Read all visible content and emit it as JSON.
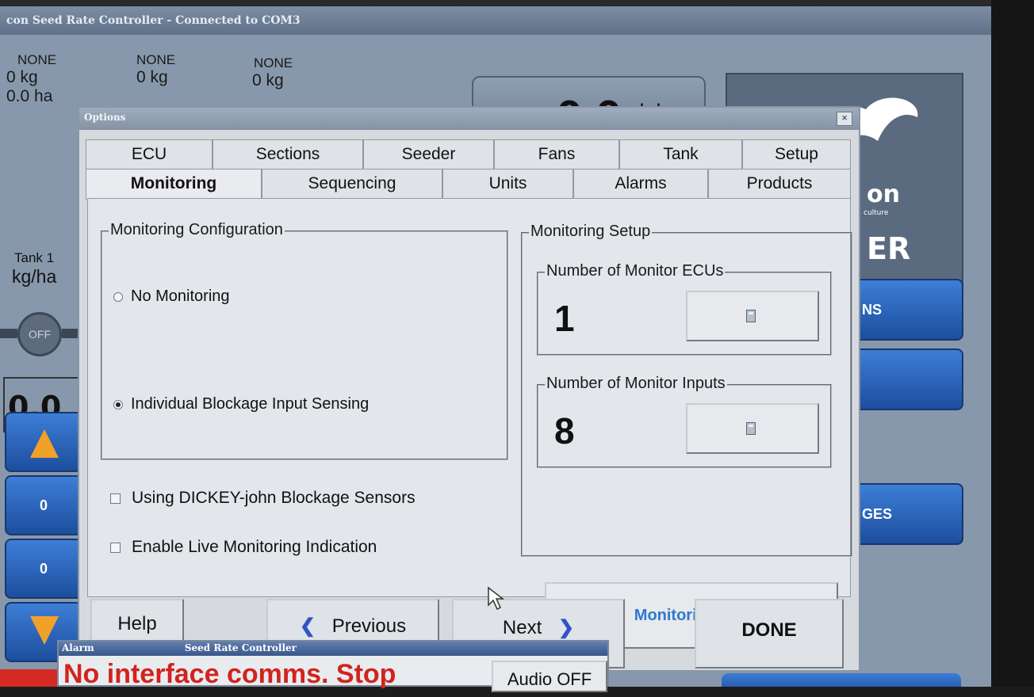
{
  "app": {
    "title": "con Seed Rate Controller - Connected to COM3",
    "stats": [
      {
        "name": "NONE",
        "mass": "0 kg",
        "area": "0.0 ha"
      },
      {
        "name": "NONE",
        "mass": "0 kg"
      },
      {
        "name": "NONE",
        "mass": "0 kg"
      }
    ],
    "speed": {
      "value": "0.0",
      "unit": "kph"
    },
    "logo": {
      "line1": "on",
      "sub": "culture",
      "line2": "ER"
    },
    "tank": {
      "label": "Tank 1",
      "unit": "kg/ha",
      "knob": "OFF",
      "rate": "0.0"
    },
    "left_buttons": [
      "0",
      "0"
    ],
    "right_buttons": [
      "NS",
      "",
      "GES"
    ],
    "accent_color": "#2f78d0"
  },
  "dialog": {
    "title": "Options",
    "close_glyph": "×",
    "tabs_back": [
      "ECU",
      "Sections",
      "Seeder",
      "Fans",
      "Tank",
      "Setup"
    ],
    "tabs_front": [
      "Monitoring",
      "Sequencing",
      "Units",
      "Alarms",
      "Products"
    ],
    "active_tab": "Monitoring",
    "monitoring_config": {
      "legend": "Monitoring Configuration",
      "options": [
        {
          "label": "No Monitoring",
          "selected": false
        },
        {
          "label": "Individual Blockage Input Sensing",
          "selected": true
        }
      ]
    },
    "checkboxes": [
      {
        "label": "Using DICKEY-john Blockage Sensors",
        "checked": false
      },
      {
        "label": "Enable Live Monitoring Indication",
        "checked": false
      }
    ],
    "monitoring_setup": {
      "legend": "Monitoring Setup",
      "ecus": {
        "legend": "Number of Monitor ECUs",
        "value": "1",
        "icon": "calculator-icon"
      },
      "inputs": {
        "legend": "Number of Monitor Inputs",
        "value": "8",
        "icon": "calculator-icon"
      },
      "list_button": "Monitoring List"
    },
    "buttons": {
      "help": "Help",
      "previous": "Previous",
      "previous_arrow": "❮",
      "next": "Next",
      "next_arrow": "❯",
      "done": "DONE"
    }
  },
  "alarm": {
    "tag": "Alarm",
    "title": "Seed Rate Controller",
    "message": "No interface comms. Stop",
    "button": "Audio OFF",
    "color": "#d2231e"
  }
}
